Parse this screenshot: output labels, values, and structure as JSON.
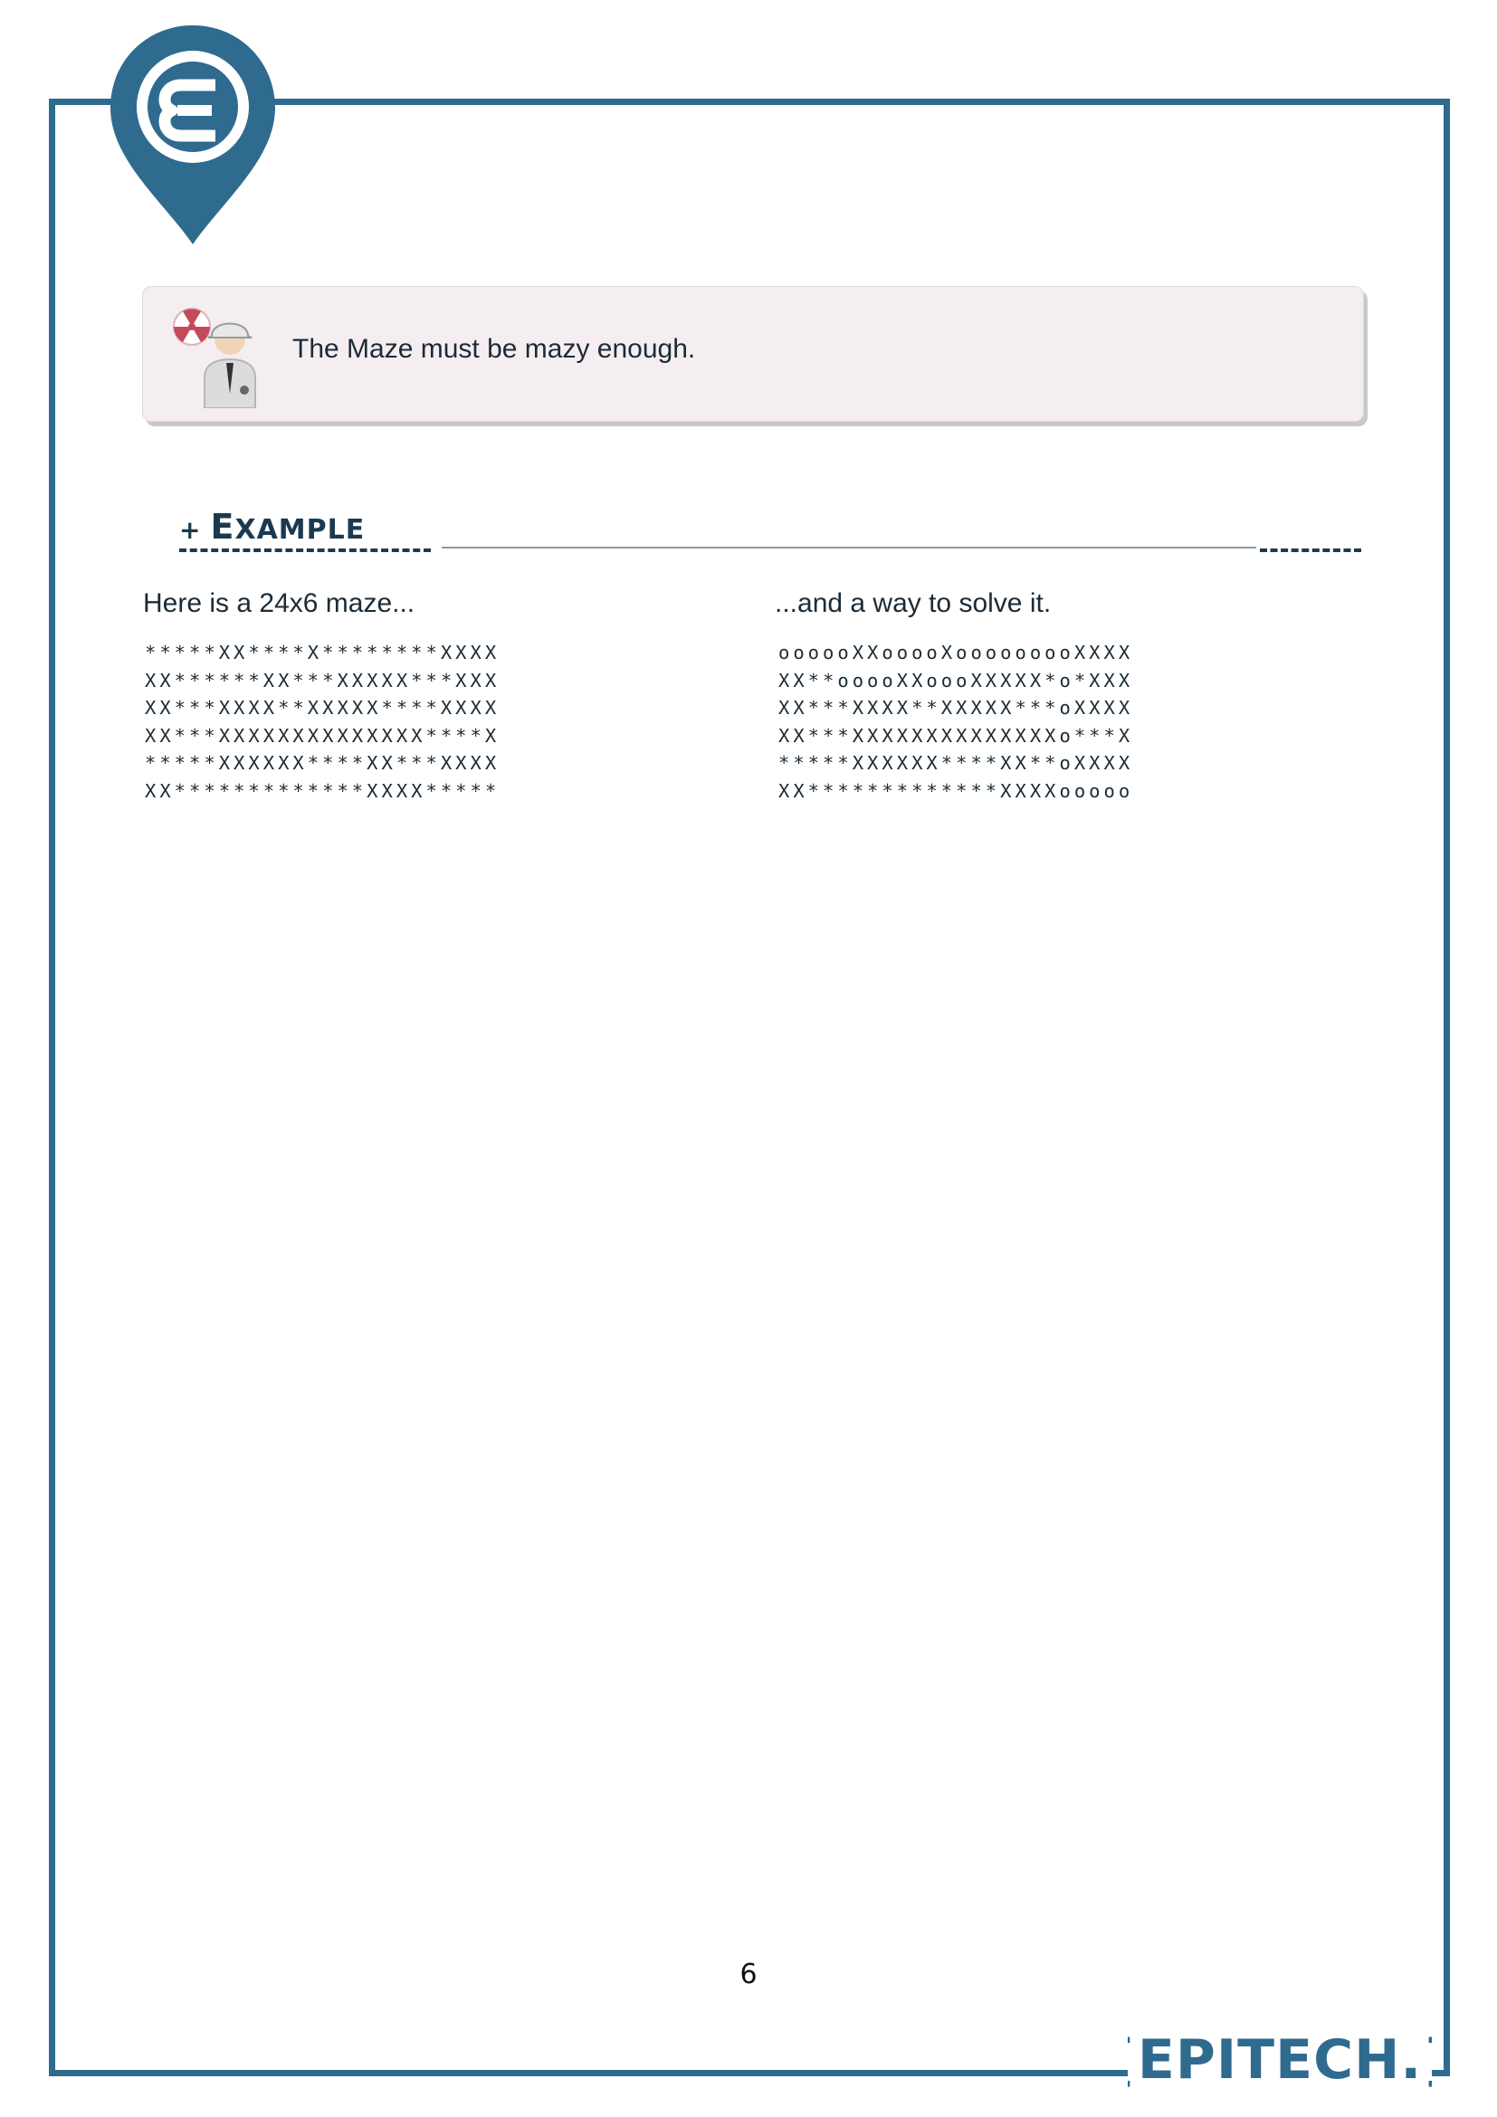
{
  "note": {
    "text": "The Maze must be mazy enough."
  },
  "section": {
    "plus": "+",
    "title_cap": "E",
    "title_rest": "XAMPLE"
  },
  "left_column": {
    "caption": "Here is a 24x6 maze...",
    "maze_rows": [
      "*****XX****X********XXXX",
      "XX******XX***XXXXX***XXX",
      "XX***XXXX**XXXXX****XXXX",
      "XX***XXXXXXXXXXXXXX****X",
      "*****XXXXXX****XX***XXXX",
      "XX*************XXXX*****"
    ]
  },
  "right_column": {
    "caption": "...and a way to solve it.",
    "maze_rows": [
      "oooooXXooooXooooooooXXXX",
      "XX**ooooXXoooXXXXX*o*XXX",
      "XX***XXXX**XXXXX***oXXXX",
      "XX***XXXXXXXXXXXXXXo***X",
      "*****XXXXXX****XX**oXXXX",
      "XX*************XXXXooooo"
    ]
  },
  "footer": {
    "page_number": "6",
    "brand": "{EPITECH.}"
  },
  "colors": {
    "frame": "#2f6a8f",
    "note_bg": "#f5eef1",
    "title": "#1c3a4f"
  }
}
